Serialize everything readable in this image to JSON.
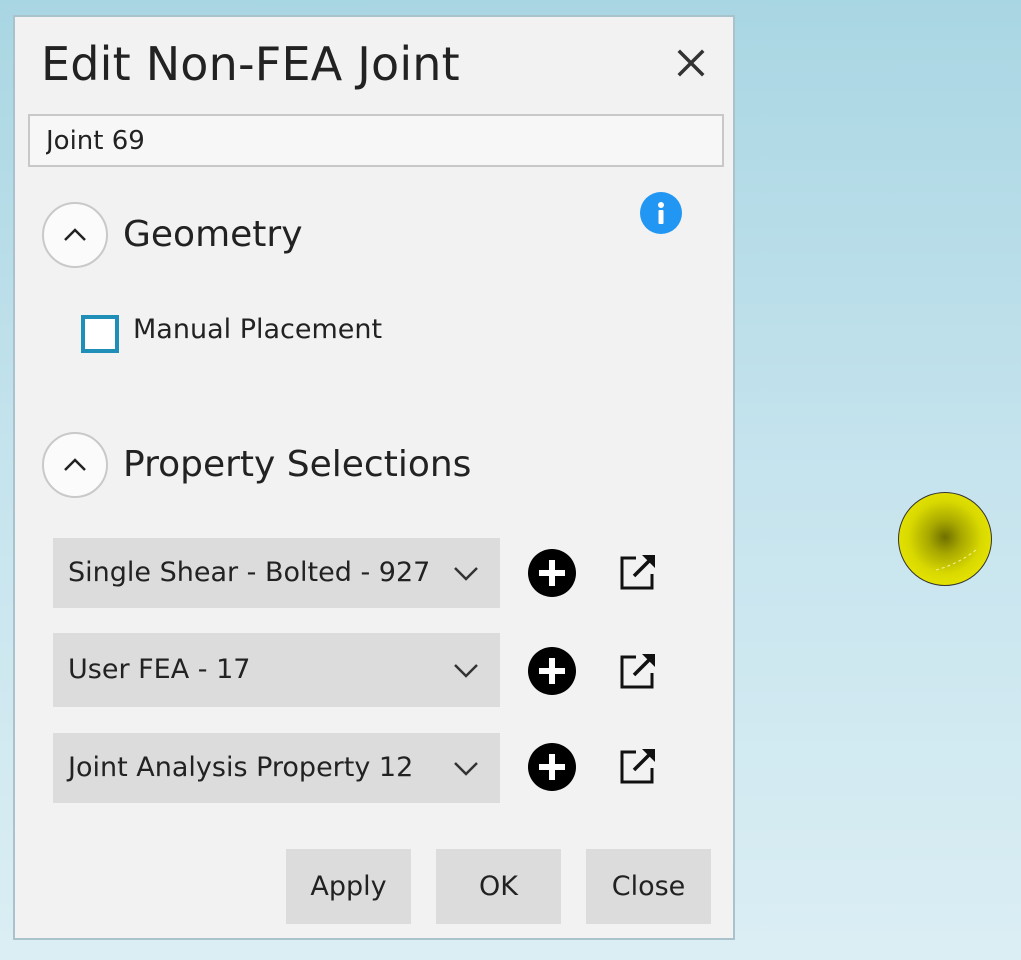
{
  "dialog": {
    "title": "Edit Non-FEA Joint",
    "name_value": "Joint 69",
    "geometry": {
      "title": "Geometry",
      "manual_placement_label": "Manual Placement",
      "manual_placement_checked": false
    },
    "properties": {
      "title": "Property Selections",
      "rows": [
        {
          "value": "Single Shear - Bolted - 927"
        },
        {
          "value": "User FEA - 17"
        },
        {
          "value": "Joint Analysis Property 12"
        }
      ]
    },
    "buttons": {
      "apply": "Apply",
      "ok": "OK",
      "close": "Close"
    }
  },
  "colors": {
    "info": "#2196f3",
    "checkbox_border": "#1f8fb8",
    "dialog_bg": "#f2f2f2",
    "dropdown_bg": "#dcdcdc",
    "sphere": "#d9d900"
  },
  "icons": [
    "close-icon",
    "info-icon",
    "chevron-up-icon",
    "chevron-down-icon",
    "add-circle-icon",
    "open-external-icon"
  ]
}
